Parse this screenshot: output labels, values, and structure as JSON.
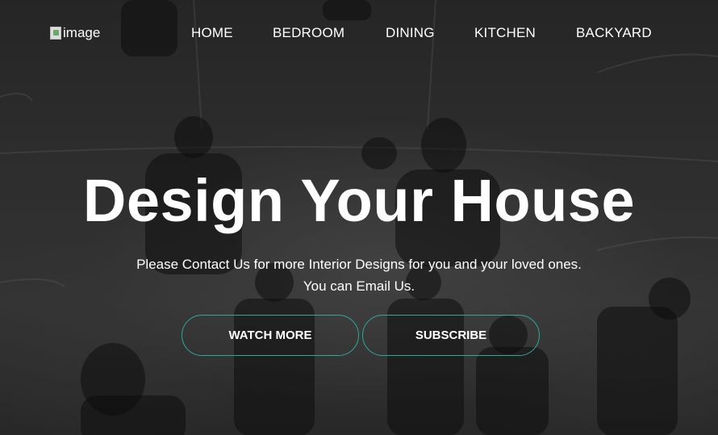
{
  "header": {
    "logo_alt": "image",
    "nav": [
      {
        "label": "HOME"
      },
      {
        "label": "BEDROOM"
      },
      {
        "label": "DINING"
      },
      {
        "label": "KITCHEN"
      },
      {
        "label": "BACKYARD"
      }
    ]
  },
  "hero": {
    "title": "Design Your House",
    "subtitle_line1": "Please Contact Us for more Interior Designs for you and your loved ones.",
    "subtitle_line2": "You can Email Us.",
    "buttons": {
      "watch_more": "WATCH MORE",
      "subscribe": "SUBSCRIBE"
    }
  },
  "colors": {
    "button_border": "#2ea99a",
    "text": "#ffffff"
  }
}
